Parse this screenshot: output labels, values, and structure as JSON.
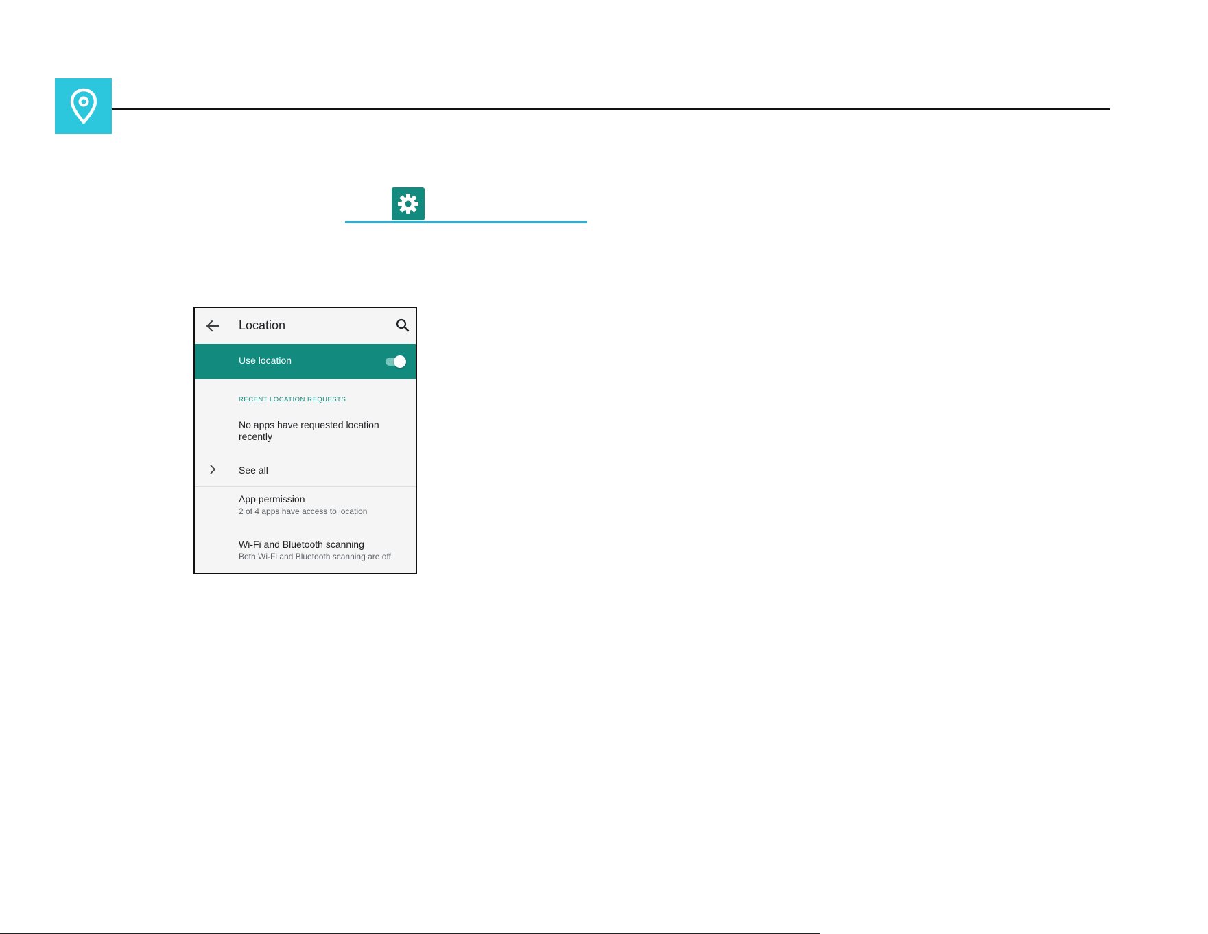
{
  "colors": {
    "location_badge": "#2cc6dd",
    "settings_badge": "#128b7e",
    "settings_rule": "#28b4d8",
    "accent_teal": "#128b7e",
    "toggle_track": "#78c7bd"
  },
  "icons": {
    "location": "location-pin-icon",
    "settings": "gear-icon",
    "back": "arrow-left-icon",
    "search": "search-icon",
    "chevron": "chevron-right-icon"
  },
  "phone": {
    "title": "Location",
    "use_location": {
      "label": "Use location",
      "enabled": true
    },
    "recent_header": "RECENT LOCATION REQUESTS",
    "recent_text": "No apps have requested location recently",
    "see_all": "See all",
    "items": [
      {
        "title": "App permission",
        "summary": "2 of 4 apps have access to location"
      },
      {
        "title": "Wi-Fi and Bluetooth scanning",
        "summary": "Both Wi-Fi and Bluetooth scanning are off"
      }
    ]
  }
}
